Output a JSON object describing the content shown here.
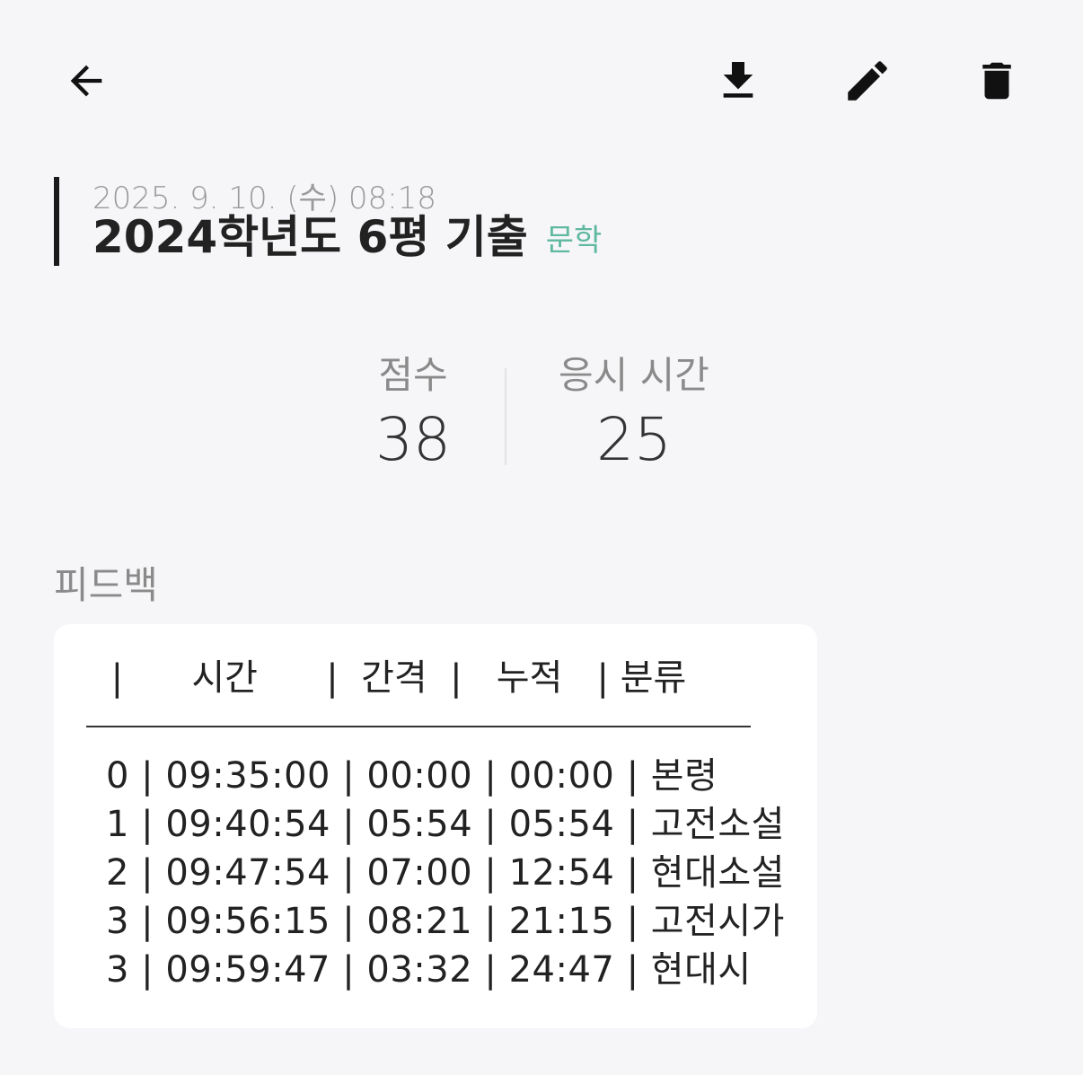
{
  "toolbar": {
    "back_icon": "arrow-left-icon",
    "download_icon": "download-icon",
    "edit_icon": "pencil-icon",
    "delete_icon": "trash-icon"
  },
  "record": {
    "date": "2025. 9. 10. (수) 08:18",
    "title": "2024학년도 6평 기출",
    "subject": "문학",
    "subject_color": "#5fb8a0"
  },
  "stats": {
    "score_label": "점수",
    "score_value": "38",
    "time_label": "응시 시간",
    "time_value": "25"
  },
  "feedback": {
    "label": "피드백",
    "header": "     |      시간      |  간격  |   누적   | 분류",
    "rows": [
      "0 | 09:35:00 | 00:00 | 00:00 | 본령",
      "1 | 09:40:54 | 05:54 | 05:54 | 고전소설",
      "2 | 09:47:54 | 07:00 | 12:54 | 현대소설",
      "3 | 09:56:15 | 08:21 | 21:15 | 고전시가",
      "3 | 09:59:47 | 03:32 | 24:47 | 현대시"
    ]
  }
}
